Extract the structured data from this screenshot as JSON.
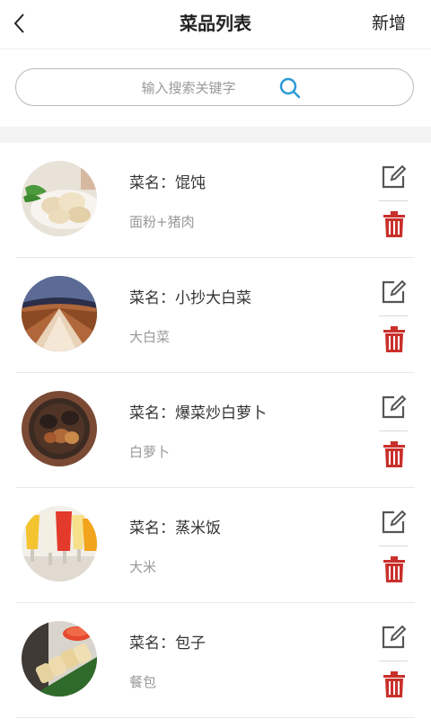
{
  "header": {
    "title": "菜品列表",
    "back_icon": "chevron-left-icon",
    "add_label": "新增"
  },
  "search": {
    "placeholder": "输入搜索关键字",
    "value": "",
    "icon": "search-icon"
  },
  "dishes": [
    {
      "name": "菜名：馄饨",
      "desc": "面粉+猪肉"
    },
    {
      "name": "菜名：小抄大白菜",
      "desc": "大白菜"
    },
    {
      "name": "菜名：爆菜炒白萝卜",
      "desc": "白萝卜"
    },
    {
      "name": "菜名：蒸米饭",
      "desc": "大米"
    },
    {
      "name": "菜名：包子",
      "desc": "餐包"
    }
  ],
  "colors": {
    "delete": "#c9302c",
    "search_icon": "#2a9bd6",
    "edit_icon": "#555555"
  }
}
